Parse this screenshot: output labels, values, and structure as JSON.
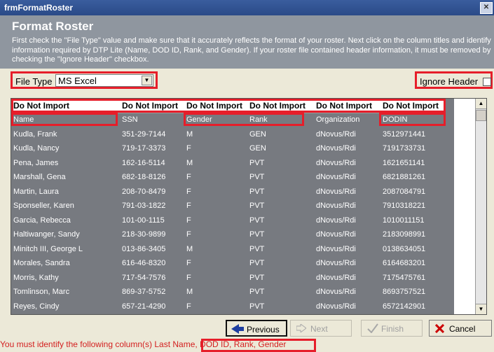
{
  "window": {
    "title": "frmFormatRoster",
    "close_glyph": "✕"
  },
  "header": {
    "title": "Format Roster",
    "description": "First check the \"File Type\" value and make sure that it accurately reflects the format of your roster.  Next click on the column titles and identify information required by DTP Lite (Name, DOD ID, Rank, and Gender).  If your roster file contained header information, it must be removed by checking the \"Ignore Header\" checkbox."
  },
  "file_type": {
    "label": "File Type",
    "value": "MS Excel"
  },
  "ignore_header": {
    "label": "Ignore Header",
    "checked": false
  },
  "grid": {
    "column_headers": [
      "Do Not Import",
      "Do Not Import",
      "Do Not Import",
      "Do Not Import",
      "Do Not Import",
      "Do Not Import"
    ],
    "rows": [
      [
        "Name",
        "SSN",
        "Gender",
        "Rank",
        "Organization",
        "DODIN"
      ],
      [
        "Kudla, Frank",
        "351-29-7144",
        "M",
        "GEN",
        "dNovus/Rdi",
        "3512971441"
      ],
      [
        "Kudla, Nancy",
        "719-17-3373",
        "F",
        "GEN",
        "dNovus/Rdi",
        "7191733731"
      ],
      [
        "Pena, James",
        "162-16-5114",
        "M",
        "PVT",
        "dNovus/Rdi",
        "1621651141"
      ],
      [
        "Marshall, Gena",
        "682-18-8126",
        "F",
        "PVT",
        "dNovus/Rdi",
        "6821881261"
      ],
      [
        "Martin, Laura",
        "208-70-8479",
        "F",
        "PVT",
        "dNovus/Rdi",
        "2087084791"
      ],
      [
        "Sponseller, Karen",
        "791-03-1822",
        "F",
        "PVT",
        "dNovus/Rdi",
        "7910318221"
      ],
      [
        "Garcia, Rebecca",
        "101-00-1115",
        "F",
        "PVT",
        "dNovus/Rdi",
        "1010011151"
      ],
      [
        "Haltiwanger, Sandy",
        "218-30-9899",
        "F",
        "PVT",
        "dNovus/Rdi",
        "2183098991"
      ],
      [
        "Minitch III, George L",
        "013-86-3405",
        "M",
        "PVT",
        "dNovus/Rdi",
        "0138634051"
      ],
      [
        "Morales, Sandra",
        "616-46-8320",
        "F",
        "PVT",
        "dNovus/Rdi",
        "6164683201"
      ],
      [
        "Morris, Kathy",
        "717-54-7576",
        "F",
        "PVT",
        "dNovus/Rdi",
        "7175475761"
      ],
      [
        "Tomlinson, Marc",
        "869-37-5752",
        "M",
        "PVT",
        "dNovus/Rdi",
        "8693757521"
      ],
      [
        "Reyes, Cindy",
        "657-21-4290",
        "F",
        "PVT",
        "dNovus/Rdi",
        "6572142901"
      ]
    ]
  },
  "buttons": {
    "previous": "Previous",
    "next": "Next",
    "finish": "Finish",
    "cancel": "Cancel"
  },
  "status": {
    "message_prefix": "You must identify the following column(s)",
    "message_required": "Last Name, DOD ID, Rank, Gender"
  },
  "colors": {
    "highlight": "#e61e2a",
    "grid_bg": "#777a80",
    "header_bg": "#8f969f",
    "message": "#d31f1f"
  }
}
